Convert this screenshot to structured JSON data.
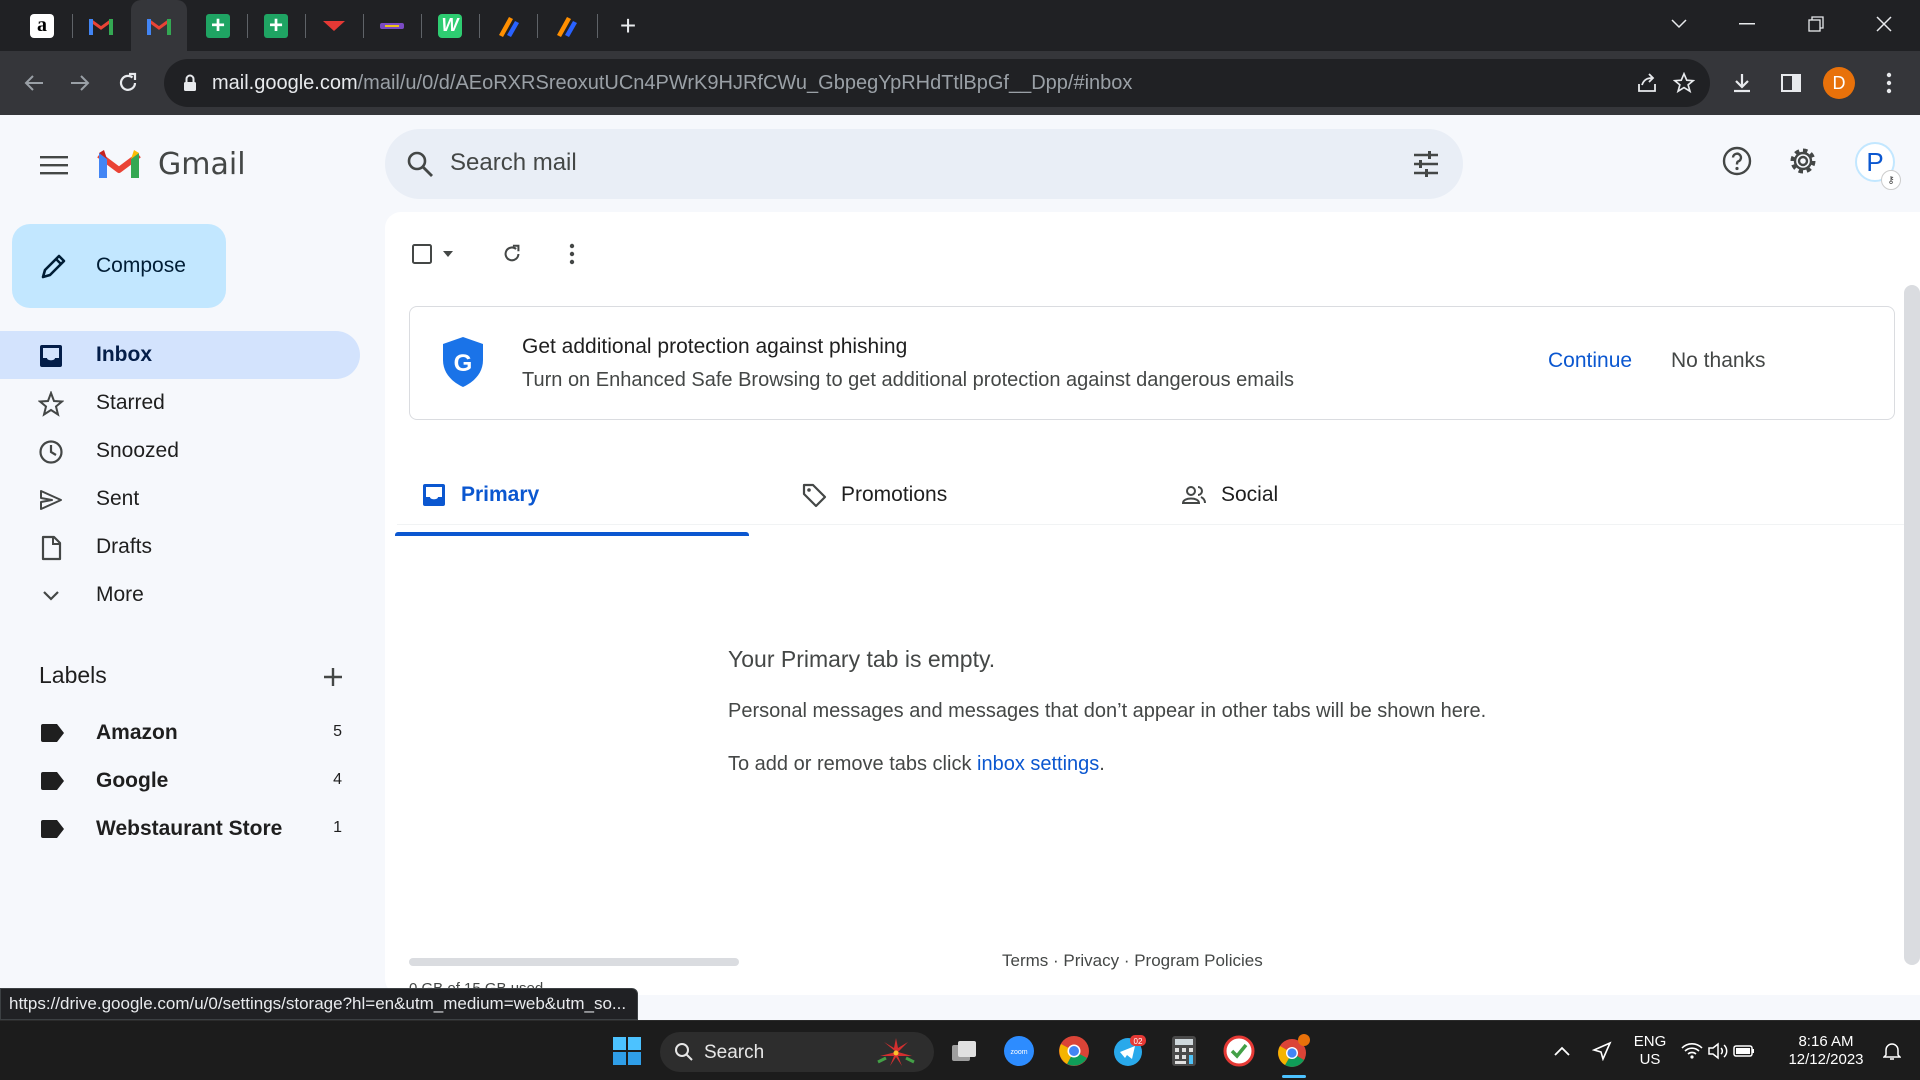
{
  "browser": {
    "tabs": [
      {
        "icon": "amazon-favicon"
      },
      {
        "icon": "gmail-favicon"
      },
      {
        "icon": "gmail-favicon",
        "active": true
      },
      {
        "icon": "google-sheets-favicon"
      },
      {
        "icon": "google-sheets-favicon"
      },
      {
        "icon": "red-logo-favicon"
      },
      {
        "icon": "purple-logo-favicon"
      },
      {
        "icon": "w-app-favicon"
      },
      {
        "icon": "pen-app-favicon"
      },
      {
        "icon": "pen-app-favicon"
      }
    ],
    "url_host": "mail.google.com",
    "url_path": "/mail/u/0/d/AEoRXRSreoxutUCn4PWrK9HJRfCWu_GbpegYpRHdTtlBpGf__Dpp/#inbox",
    "profile_initial": "D",
    "status_url": "https://drive.google.com/u/0/settings/storage?hl=en&utm_medium=web&utm_so..."
  },
  "gmail": {
    "brand": "Gmail",
    "search_placeholder": "Search mail",
    "account_initial": "P",
    "compose_label": "Compose",
    "nav": [
      {
        "label": "Inbox",
        "icon": "inbox-icon",
        "active": true
      },
      {
        "label": "Starred",
        "icon": "star-icon"
      },
      {
        "label": "Snoozed",
        "icon": "clock-icon"
      },
      {
        "label": "Sent",
        "icon": "send-icon"
      },
      {
        "label": "Drafts",
        "icon": "draft-icon"
      },
      {
        "label": "More",
        "icon": "chevron-down-icon"
      }
    ],
    "labels_title": "Labels",
    "labels": [
      {
        "name": "Amazon",
        "count": "5"
      },
      {
        "name": "Google",
        "count": "4"
      },
      {
        "name": "Webstaurant Store",
        "count": "1"
      }
    ],
    "banner": {
      "title": "Get additional protection against phishing",
      "subtitle": "Turn on Enhanced Safe Browsing to get additional protection against dangerous emails",
      "continue": "Continue",
      "no_thanks": "No thanks"
    },
    "category_tabs": [
      {
        "label": "Primary",
        "active": true
      },
      {
        "label": "Promotions"
      },
      {
        "label": "Social"
      }
    ],
    "empty": {
      "title": "Your Primary tab is empty.",
      "message": "Personal messages and messages that don’t appear in other tabs will be shown here.",
      "hint_prefix": "To add or remove tabs click ",
      "hint_link": "inbox settings",
      "hint_suffix": "."
    },
    "footer": "Terms · Privacy · Program Policies",
    "storage": "0 GB of 15 GB used"
  },
  "taskbar": {
    "search_label": "Search",
    "lang": "ENG",
    "region": "US",
    "time": "8:16 AM",
    "date": "12/12/2023",
    "telegram_badge": "02",
    "zoom_label": "zoom"
  },
  "colors": {
    "accent": "#0b57d0",
    "compose_bg": "#c2e7ff",
    "nav_active_bg": "#d3e3fd",
    "gmail_red": "#ea4335",
    "profile_orange": "#e8710a"
  }
}
